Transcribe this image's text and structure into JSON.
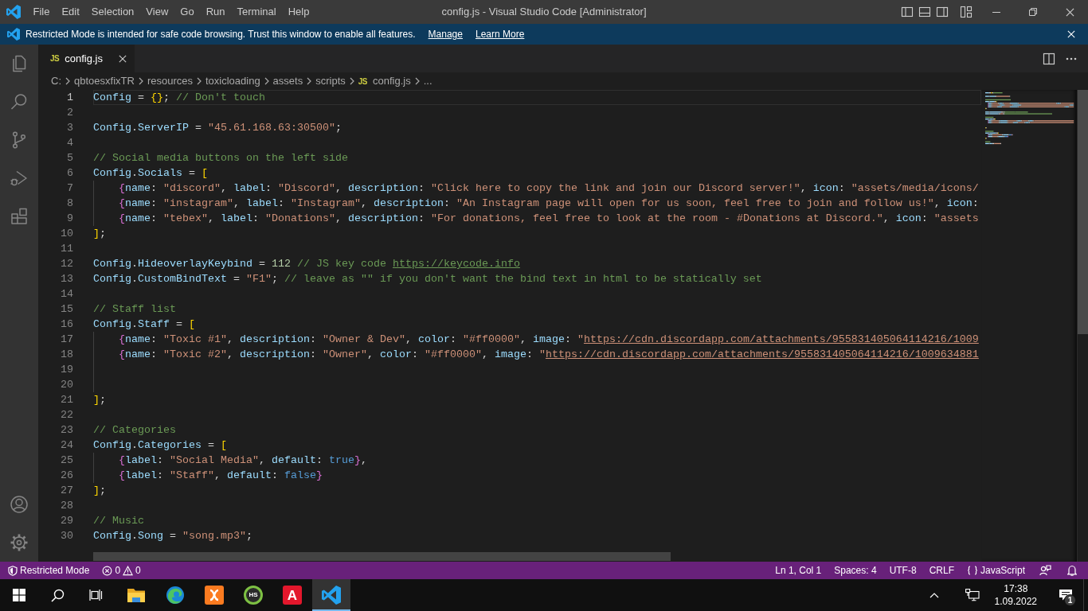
{
  "title_bar": {
    "menu": [
      "File",
      "Edit",
      "Selection",
      "View",
      "Go",
      "Run",
      "Terminal",
      "Help"
    ],
    "title": "config.js - Visual Studio Code [Administrator]"
  },
  "banner": {
    "message": "Restricted Mode is intended for safe code browsing. Trust this window to enable all features.",
    "links": [
      "Manage",
      "Learn More"
    ]
  },
  "tabs": [
    {
      "file_icon": "JS",
      "label": "config.js",
      "selected": true
    }
  ],
  "breadcrumb": [
    {
      "text": "C:"
    },
    {
      "text": "qbtoesxfixTR"
    },
    {
      "text": "resources"
    },
    {
      "text": "toxicloading"
    },
    {
      "text": "assets"
    },
    {
      "text": "scripts"
    },
    {
      "file_icon": "JS",
      "text": "config.js"
    },
    {
      "text": "..."
    }
  ],
  "editor": {
    "lines": [
      {
        "number": "1",
        "selected": true,
        "tokens": [
          {
            "kind": "variable",
            "text": "Config"
          },
          {
            "kind": "punct",
            "text": " = "
          },
          {
            "kind": "bracket",
            "text": "{}"
          },
          {
            "kind": "punct",
            "text": "; "
          },
          {
            "kind": "comment",
            "text": "// Don't touch"
          }
        ]
      },
      {
        "number": "2",
        "selected": false
      },
      {
        "number": "3",
        "selected": false,
        "tokens": [
          {
            "kind": "variable",
            "text": "Config"
          },
          {
            "kind": "punct",
            "text": "."
          },
          {
            "kind": "variable",
            "text": "ServerIP"
          },
          {
            "kind": "punct",
            "text": " = "
          },
          {
            "kind": "string",
            "text": "\"45.61.168.63:30500\""
          },
          {
            "kind": "punct",
            "text": ";"
          }
        ]
      },
      {
        "number": "4",
        "selected": false
      },
      {
        "number": "5",
        "selected": false,
        "tokens": [
          {
            "kind": "comment",
            "text": "// Social media buttons on the left side"
          }
        ]
      },
      {
        "number": "6",
        "selected": false,
        "tokens": [
          {
            "kind": "variable",
            "text": "Config"
          },
          {
            "kind": "punct",
            "text": "."
          },
          {
            "kind": "variable",
            "text": "Socials"
          },
          {
            "kind": "punct",
            "text": " = "
          },
          {
            "kind": "bracket",
            "text": "["
          }
        ],
        "children": [
          {
            "number": "7",
            "selected": false,
            "tokens": [
              {
                "kind": "innerbracket",
                "text": "{"
              },
              {
                "kind": "variable",
                "text": "name"
              },
              {
                "kind": "punct",
                "text": ": "
              },
              {
                "kind": "string",
                "text": "\"discord\""
              },
              {
                "kind": "punct",
                "text": ", "
              },
              {
                "kind": "variable",
                "text": "label"
              },
              {
                "kind": "punct",
                "text": ": "
              },
              {
                "kind": "string",
                "text": "\"Discord\""
              },
              {
                "kind": "punct",
                "text": ", "
              },
              {
                "kind": "variable",
                "text": "description"
              },
              {
                "kind": "punct",
                "text": ": "
              },
              {
                "kind": "string",
                "text": "\"Click here to copy the link and join our Discord server!\""
              },
              {
                "kind": "punct",
                "text": ", "
              },
              {
                "kind": "variable",
                "text": "icon"
              },
              {
                "kind": "punct",
                "text": ": "
              },
              {
                "kind": "string",
                "text": "\"assets/media/icons/"
              }
            ]
          },
          {
            "number": "8",
            "selected": false,
            "tokens": [
              {
                "kind": "innerbracket",
                "text": "{"
              },
              {
                "kind": "variable",
                "text": "name"
              },
              {
                "kind": "punct",
                "text": ": "
              },
              {
                "kind": "string",
                "text": "\"instagram\""
              },
              {
                "kind": "punct",
                "text": ", "
              },
              {
                "kind": "variable",
                "text": "label"
              },
              {
                "kind": "punct",
                "text": ": "
              },
              {
                "kind": "string",
                "text": "\"Instagram\""
              },
              {
                "kind": "punct",
                "text": ", "
              },
              {
                "kind": "variable",
                "text": "description"
              },
              {
                "kind": "punct",
                "text": ": "
              },
              {
                "kind": "string",
                "text": "\"An Instagram page will open for us soon, feel free to join and follow us!\""
              },
              {
                "kind": "punct",
                "text": ", "
              },
              {
                "kind": "variable",
                "text": "icon"
              },
              {
                "kind": "punct",
                "text": ":"
              }
            ]
          },
          {
            "number": "9",
            "selected": false,
            "tokens": [
              {
                "kind": "innerbracket",
                "text": "{"
              },
              {
                "kind": "variable",
                "text": "name"
              },
              {
                "kind": "punct",
                "text": ": "
              },
              {
                "kind": "string",
                "text": "\"tebex\""
              },
              {
                "kind": "punct",
                "text": ", "
              },
              {
                "kind": "variable",
                "text": "label"
              },
              {
                "kind": "punct",
                "text": ": "
              },
              {
                "kind": "string",
                "text": "\"Donations\""
              },
              {
                "kind": "punct",
                "text": ", "
              },
              {
                "kind": "variable",
                "text": "description"
              },
              {
                "kind": "punct",
                "text": ": "
              },
              {
                "kind": "string",
                "text": "\"For donations, feel free to look at the room - #Donations at Discord.\""
              },
              {
                "kind": "punct",
                "text": ", "
              },
              {
                "kind": "variable",
                "text": "icon"
              },
              {
                "kind": "punct",
                "text": ": "
              },
              {
                "kind": "string",
                "text": "\"assets"
              }
            ]
          }
        ]
      },
      {
        "number": "10",
        "selected": false,
        "tokens": [
          {
            "kind": "bracket",
            "text": "]"
          },
          {
            "kind": "punct",
            "text": ";"
          }
        ]
      },
      {
        "number": "11",
        "selected": false
      },
      {
        "number": "12",
        "selected": false,
        "tokens": [
          {
            "kind": "variable",
            "text": "Config"
          },
          {
            "kind": "punct",
            "text": "."
          },
          {
            "kind": "variable",
            "text": "HideoverlayKeybind"
          },
          {
            "kind": "punct",
            "text": " = "
          },
          {
            "kind": "number",
            "text": "112"
          },
          {
            "kind": "comment",
            "text": " // JS key code "
          },
          {
            "kind": "commenturl",
            "text": "https://keycode.info"
          }
        ]
      },
      {
        "number": "13",
        "selected": false,
        "tokens": [
          {
            "kind": "variable",
            "text": "Config"
          },
          {
            "kind": "punct",
            "text": "."
          },
          {
            "kind": "variable",
            "text": "CustomBindText"
          },
          {
            "kind": "punct",
            "text": " = "
          },
          {
            "kind": "string",
            "text": "\"F1\""
          },
          {
            "kind": "punct",
            "text": "; "
          },
          {
            "kind": "comment",
            "text": "// leave as \"\" if you don't want the bind text in html to be statically set"
          }
        ]
      },
      {
        "number": "14",
        "selected": false
      },
      {
        "number": "15",
        "selected": false,
        "tokens": [
          {
            "kind": "comment",
            "text": "// Staff list"
          }
        ]
      },
      {
        "number": "16",
        "selected": false,
        "tokens": [
          {
            "kind": "variable",
            "text": "Config"
          },
          {
            "kind": "punct",
            "text": "."
          },
          {
            "kind": "variable",
            "text": "Staff"
          },
          {
            "kind": "punct",
            "text": " = "
          },
          {
            "kind": "bracket",
            "text": "["
          }
        ],
        "children": [
          {
            "number": "17",
            "selected": false,
            "tokens": [
              {
                "kind": "innerbracket",
                "text": "{"
              },
              {
                "kind": "variable",
                "text": "name"
              },
              {
                "kind": "punct",
                "text": ": "
              },
              {
                "kind": "string",
                "text": "\"Toxic #1\""
              },
              {
                "kind": "punct",
                "text": ", "
              },
              {
                "kind": "variable",
                "text": "description"
              },
              {
                "kind": "punct",
                "text": ": "
              },
              {
                "kind": "string",
                "text": "\"Owner & Dev\""
              },
              {
                "kind": "punct",
                "text": ", "
              },
              {
                "kind": "variable",
                "text": "color"
              },
              {
                "kind": "punct",
                "text": ": "
              },
              {
                "kind": "string",
                "text": "\"#ff0000\""
              },
              {
                "kind": "punct",
                "text": ", "
              },
              {
                "kind": "variable",
                "text": "image"
              },
              {
                "kind": "punct",
                "text": ": "
              },
              {
                "kind": "string",
                "text": "\""
              },
              {
                "kind": "url",
                "text": "https://cdn.discordapp.com/attachments/955831405064114216/1009"
              }
            ]
          },
          {
            "number": "18",
            "selected": false,
            "tokens": [
              {
                "kind": "innerbracket",
                "text": "{"
              },
              {
                "kind": "variable",
                "text": "name"
              },
              {
                "kind": "punct",
                "text": ": "
              },
              {
                "kind": "string",
                "text": "\"Toxic #2\""
              },
              {
                "kind": "punct",
                "text": ", "
              },
              {
                "kind": "variable",
                "text": "description"
              },
              {
                "kind": "punct",
                "text": ": "
              },
              {
                "kind": "string",
                "text": "\"Owner\""
              },
              {
                "kind": "punct",
                "text": ", "
              },
              {
                "kind": "variable",
                "text": "color"
              },
              {
                "kind": "punct",
                "text": ": "
              },
              {
                "kind": "string",
                "text": "\"#ff0000\""
              },
              {
                "kind": "punct",
                "text": ", "
              },
              {
                "kind": "variable",
                "text": "image"
              },
              {
                "kind": "punct",
                "text": ": "
              },
              {
                "kind": "string",
                "text": "\""
              },
              {
                "kind": "url",
                "text": "https://cdn.discordapp.com/attachments/955831405064114216/1009634881"
              }
            ]
          },
          {
            "number": "19",
            "selected": false
          },
          {
            "number": "20",
            "selected": false
          }
        ]
      },
      {
        "number": "21",
        "selected": false,
        "tokens": [
          {
            "kind": "bracket",
            "text": "]"
          },
          {
            "kind": "punct",
            "text": ";"
          }
        ]
      },
      {
        "number": "22",
        "selected": false
      },
      {
        "number": "23",
        "selected": false,
        "tokens": [
          {
            "kind": "comment",
            "text": "// Categories"
          }
        ]
      },
      {
        "number": "24",
        "selected": false,
        "tokens": [
          {
            "kind": "variable",
            "text": "Config"
          },
          {
            "kind": "punct",
            "text": "."
          },
          {
            "kind": "variable",
            "text": "Categories"
          },
          {
            "kind": "punct",
            "text": " = "
          },
          {
            "kind": "bracket",
            "text": "["
          }
        ],
        "children": [
          {
            "number": "25",
            "selected": false,
            "tokens": [
              {
                "kind": "innerbracket",
                "text": "{"
              },
              {
                "kind": "variable",
                "text": "label"
              },
              {
                "kind": "punct",
                "text": ": "
              },
              {
                "kind": "string",
                "text": "\"Social Media\""
              },
              {
                "kind": "punct",
                "text": ", "
              },
              {
                "kind": "variable",
                "text": "default"
              },
              {
                "kind": "punct",
                "text": ": "
              },
              {
                "kind": "literal",
                "text": "true"
              },
              {
                "kind": "innerbracket",
                "text": "}"
              },
              {
                "kind": "punct",
                "text": ","
              }
            ]
          },
          {
            "number": "26",
            "selected": false,
            "tokens": [
              {
                "kind": "innerbracket",
                "text": "{"
              },
              {
                "kind": "variable",
                "text": "label"
              },
              {
                "kind": "punct",
                "text": ": "
              },
              {
                "kind": "string",
                "text": "\"Staff\""
              },
              {
                "kind": "punct",
                "text": ", "
              },
              {
                "kind": "variable",
                "text": "default"
              },
              {
                "kind": "punct",
                "text": ": "
              },
              {
                "kind": "literal",
                "text": "false"
              },
              {
                "kind": "innerbracket",
                "text": "}"
              }
            ]
          }
        ]
      },
      {
        "number": "27",
        "selected": false,
        "tokens": [
          {
            "kind": "bracket",
            "text": "]"
          },
          {
            "kind": "punct",
            "text": ";"
          }
        ]
      },
      {
        "number": "28",
        "selected": false
      },
      {
        "number": "29",
        "selected": false,
        "tokens": [
          {
            "kind": "comment",
            "text": "// Music"
          }
        ]
      },
      {
        "number": "30",
        "selected": false,
        "tokens": [
          {
            "kind": "variable",
            "text": "Config"
          },
          {
            "kind": "punct",
            "text": "."
          },
          {
            "kind": "variable",
            "text": "Song"
          },
          {
            "kind": "punct",
            "text": " = "
          },
          {
            "kind": "string",
            "text": "\"song.mp3\""
          },
          {
            "kind": "punct",
            "text": ";"
          }
        ]
      }
    ]
  },
  "status_bar": {
    "left": [
      {
        "kind": "restricted",
        "text": "Restricted Mode"
      },
      {
        "kind": "problems",
        "errors": "0",
        "warnings": "0"
      }
    ],
    "right": [
      {
        "kind": "text",
        "text": "Ln 1, Col 1"
      },
      {
        "kind": "text",
        "text": "Spaces: 4"
      },
      {
        "kind": "text",
        "text": "UTF-8"
      },
      {
        "kind": "text",
        "text": "CRLF"
      },
      {
        "kind": "language",
        "text": "JavaScript"
      },
      {
        "kind": "feedback"
      },
      {
        "kind": "bell"
      }
    ]
  },
  "taskbar": {
    "apps": [
      {
        "kind": "folder",
        "selected": false
      },
      {
        "kind": "browser",
        "selected": false
      },
      {
        "kind": "xampp",
        "selected": false
      },
      {
        "kind": "ring",
        "text": "HS",
        "selected": false
      },
      {
        "kind": "tile",
        "text": "A",
        "selected": false
      },
      {
        "kind": "editor",
        "selected": true
      }
    ],
    "tray": {
      "time": "17:38",
      "date": "1.09.2022",
      "notifications": "1"
    }
  }
}
